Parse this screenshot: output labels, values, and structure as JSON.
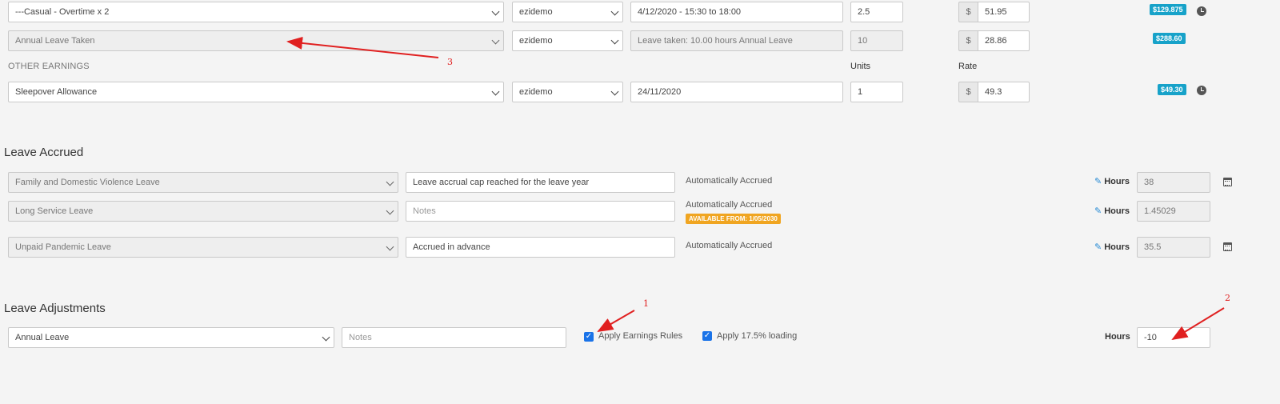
{
  "earnings": {
    "row1": {
      "type": "---Casual - Overtime x 2",
      "user": "ezidemo",
      "desc": "4/12/2020 - 15:30 to 18:00",
      "units": "2.5",
      "currency": "$",
      "rate": "51.95",
      "total": "$129.875"
    },
    "row2": {
      "type": "Annual Leave Taken",
      "user": "ezidemo",
      "desc": "Leave taken: 10.00 hours Annual Leave",
      "units": "10",
      "currency": "$",
      "rate": "28.86",
      "total": "$288.60"
    }
  },
  "other_earnings": {
    "heading": "OTHER EARNINGS",
    "units_label": "Units",
    "rate_label": "Rate",
    "row": {
      "type": "Sleepover Allowance",
      "user": "ezidemo",
      "desc": "24/11/2020",
      "units": "1",
      "currency": "$",
      "rate": "49.3",
      "total": "$49.30"
    }
  },
  "leave_accrued": {
    "heading": "Leave Accrued",
    "rows": [
      {
        "type": "Family and Domestic Violence Leave",
        "notes": "Leave accrual cap reached for the leave year",
        "notes_placeholder": "Notes",
        "status": "Automatically Accrued",
        "hours_label": "Hours",
        "hours": "38"
      },
      {
        "type": "Long Service Leave",
        "notes": "",
        "notes_placeholder": "Notes",
        "status": "Automatically Accrued",
        "available": "AVAILABLE FROM: 1/05/2030",
        "hours_label": "Hours",
        "hours": "1.45029"
      },
      {
        "type": "Unpaid Pandemic Leave",
        "notes": "Accrued in advance",
        "notes_placeholder": "Notes",
        "status": "Automatically Accrued",
        "hours_label": "Hours",
        "hours": "35.5"
      }
    ]
  },
  "leave_adjustments": {
    "heading": "Leave Adjustments",
    "type": "Annual Leave",
    "notes_placeholder": "Notes",
    "apply_earnings_rules": {
      "label": "Apply Earnings Rules",
      "checked": true
    },
    "apply_loading": {
      "label": "Apply 17.5% loading",
      "checked": true
    },
    "hours_label": "Hours",
    "hours": "-10"
  },
  "annotations": {
    "a1": "1",
    "a2": "2",
    "a3": "3"
  },
  "colors": {
    "badge": "#17a2c9",
    "available_badge": "#f0a521",
    "annotation": "#e02020",
    "checkbox": "#1a73e8"
  }
}
